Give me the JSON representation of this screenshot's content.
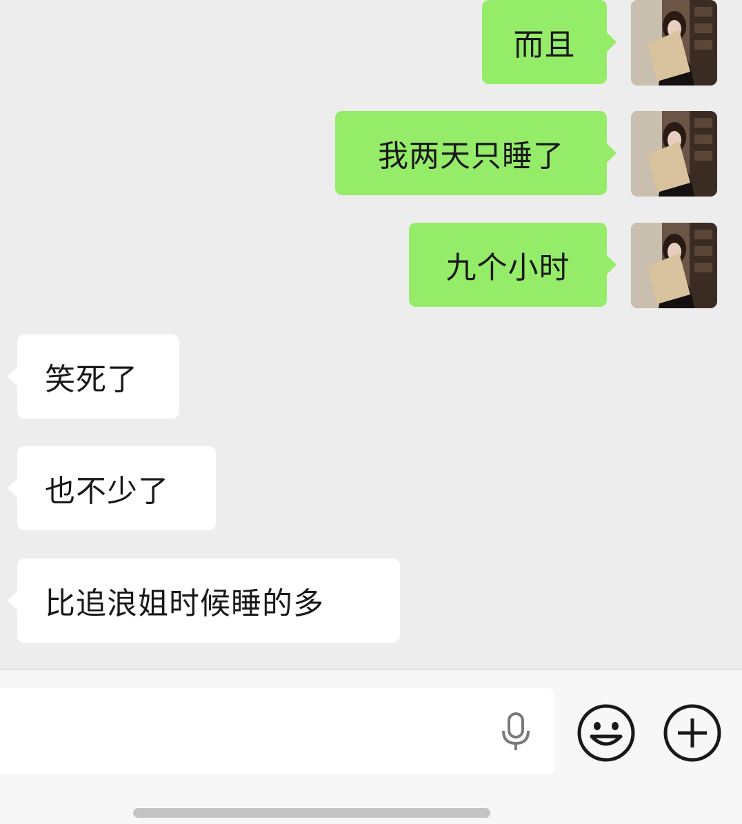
{
  "messages": [
    {
      "direction": "out",
      "text": "而且"
    },
    {
      "direction": "out",
      "text": "我两天只睡了"
    },
    {
      "direction": "out",
      "text": "九个小时"
    },
    {
      "direction": "in",
      "text": "笑死了"
    },
    {
      "direction": "in",
      "text": "也不少了"
    },
    {
      "direction": "in",
      "text": "比追浪姐时候睡的多"
    }
  ],
  "colors": {
    "background": "#ededed",
    "outgoing_bubble": "#95ec69",
    "incoming_bubble": "#ffffff",
    "text": "#191919"
  },
  "input_bar": {
    "value": "",
    "icons": [
      "microphone-icon",
      "emoji-icon",
      "plus-icon"
    ]
  }
}
